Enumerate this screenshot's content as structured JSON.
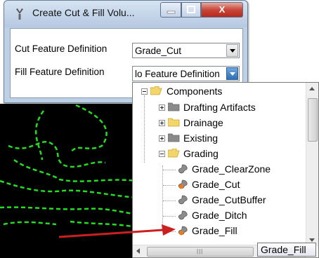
{
  "window": {
    "title": "Create Cut & Fill Volu...",
    "buttons": {
      "minimize": "—",
      "maximize": "□",
      "close": "X"
    }
  },
  "form": {
    "cut_label": "Cut Feature Definition",
    "cut_value": "Grade_Cut",
    "fill_label": "Fill Feature Definition",
    "fill_value": "lo Feature Definition"
  },
  "tree": {
    "root": {
      "label": "Components",
      "icon": "folder-open-icon"
    },
    "children": [
      {
        "label": "Drafting Artifacts",
        "icon": "folder-gray-icon",
        "expander": "plus"
      },
      {
        "label": "Drainage",
        "icon": "folder-yellow-icon",
        "expander": "plus"
      },
      {
        "label": "Existing",
        "icon": "folder-gray-icon",
        "expander": "plus"
      },
      {
        "label": "Grading",
        "icon": "folder-open-icon",
        "expander": "minus"
      }
    ],
    "grading_items": [
      {
        "label": "Grade_ClearZone",
        "icon": "feature-gray-icon"
      },
      {
        "label": "Grade_Cut",
        "icon": "feature-orange-icon"
      },
      {
        "label": "Grade_CutBuffer",
        "icon": "feature-gray-icon"
      },
      {
        "label": "Grade_Ditch",
        "icon": "feature-gray-icon"
      },
      {
        "label": "Grade_Fill",
        "icon": "feature-orange-icon"
      }
    ]
  },
  "tooltip": "Grade_Fill",
  "colors": {
    "cad_background": "#000000",
    "cad_lines": "#22dd22",
    "annotation_arrow": "#cc1f1f"
  }
}
